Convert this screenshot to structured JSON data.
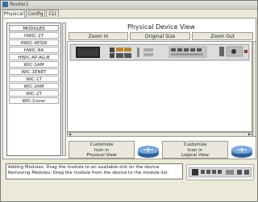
{
  "window": {
    "title": "Router1"
  },
  "tabs": [
    {
      "label": "Physical",
      "active": true
    },
    {
      "label": "Config",
      "active": false
    },
    {
      "label": "CLI",
      "active": false
    }
  ],
  "modules": {
    "header": "MODULES",
    "items": [
      "HWIC-2T",
      "HWIC-4ESW",
      "HWIC-8A",
      "HWIC-AP-AG-B",
      "WIC-1AM",
      "WIC-1ENET",
      "WIC-1T",
      "WIC-2AM",
      "WIC-2T",
      "WIC-Cover"
    ]
  },
  "view": {
    "title": "Physical Device View",
    "zoom_in": "Zoom In",
    "original_size": "Original Size",
    "zoom_out": "Zoom Out"
  },
  "customize": {
    "physical_label": "Customize\nIcon in\nPhysical View",
    "logical_label": "Customize\nIcon in\nLogical View"
  },
  "info": {
    "line1": "Adding Modules: Drag the module to an available slot on the device.",
    "line2": "Removing Modules: Drag the module from the device to the module list."
  },
  "colors": {
    "accent": "#2e6db0",
    "router_blue": "#4d7fb8"
  }
}
